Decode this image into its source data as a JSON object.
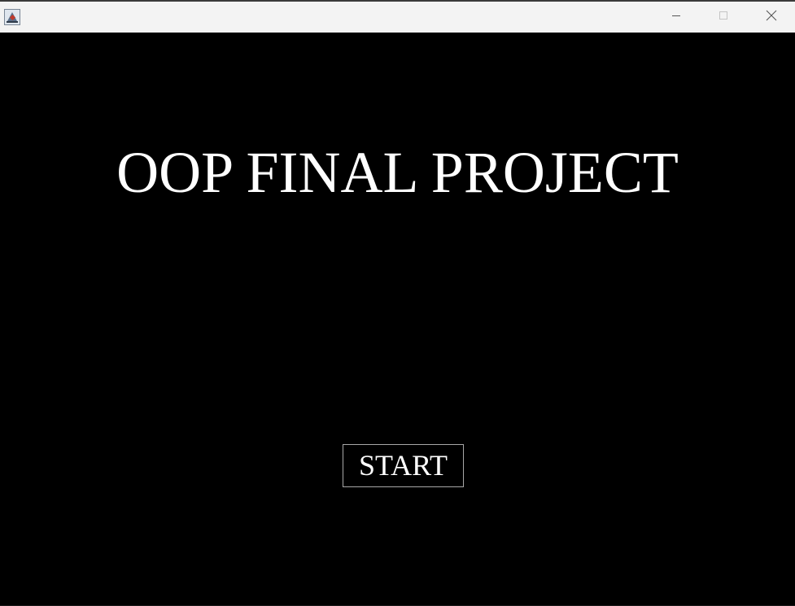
{
  "window": {
    "icon": "java-coffee-cup-icon",
    "controls": {
      "minimize_icon": "minimize-icon",
      "maximize_icon": "maximize-icon",
      "close_icon": "close-icon"
    }
  },
  "screen": {
    "background_color": "#000000",
    "title": "OOP FINAL PROJECT",
    "start_button_label": "START"
  }
}
